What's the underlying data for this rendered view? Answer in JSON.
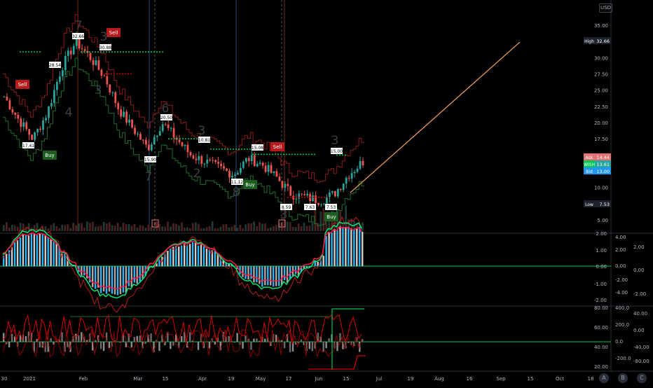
{
  "currency_button": "USD",
  "colors": {
    "background": "#000000",
    "up": "#26a69a",
    "down": "#ef5350",
    "green_bright": "#00e676",
    "red_bright": "#ff1744",
    "orange_line": "#f6a35a",
    "axis_text": "#b2b5be"
  },
  "price_axis": {
    "ticks": [
      "35.00",
      "32.50",
      "30.00",
      "27.50",
      "25.00",
      "22.50",
      "20.00",
      "17.50",
      "15.00",
      "12.50",
      "10.00",
      "7.50",
      "5.00"
    ],
    "labels": {
      "high": "High",
      "high_value": "32.66",
      "ask": "Ask",
      "ask_value": "14.44",
      "wish": "WISH",
      "wish_value": "13.61",
      "bid": "Bid",
      "bid_value": "13.00",
      "low": "Low",
      "low_value": "7.53"
    }
  },
  "osc1_axis": {
    "left": [
      "2.00",
      "1.00",
      "0.00",
      "-1.00",
      "-2.00"
    ],
    "mid": [
      "4.00",
      "2.00",
      "0.00",
      "-2.00",
      "-4.00"
    ],
    "right": [
      "2.00",
      "0.00",
      "-2.00"
    ]
  },
  "osc2_axis": {
    "left": [
      "80.00",
      "60.00",
      "40.00",
      "20.00"
    ],
    "mid": [
      "400.0",
      "200.0",
      "0.0",
      "-200.0"
    ],
    "right": [
      "40.00",
      "0.00",
      "-40.00",
      "-80.00"
    ]
  },
  "time_axis": [
    "30",
    "2021",
    "Feb",
    "Mar",
    "15",
    "Apr",
    "19",
    "May",
    "17",
    "Jun",
    "15",
    "Jul",
    "19",
    "Aug",
    "16",
    "Sep",
    "15",
    "Oct",
    "18"
  ],
  "bottom_buttons": [
    "A",
    "B",
    "C"
  ],
  "annotations": {
    "sell": "Sell",
    "buy": "Buy",
    "price_tags": [
      "32.66",
      "28.54",
      "30.88",
      "17.41",
      "20.50",
      "10.81",
      "15.90",
      "15.08",
      "11.12",
      "8.59",
      "7.53",
      "7.63",
      "15.00"
    ],
    "digits": [
      "7",
      "3",
      "4",
      "3",
      "6",
      "3",
      "7",
      "2",
      "8",
      "3",
      "3"
    ],
    "event_marker": "E"
  },
  "chart_data": {
    "type": "line",
    "title": "",
    "symbol": "WISH",
    "xlabel": "",
    "ylabel": "USD",
    "ylim": [
      4,
      36
    ],
    "x": [
      "2020-12-30",
      "2021-01-05",
      "2021-01-12",
      "2021-01-19",
      "2021-01-26",
      "2021-02-02",
      "2021-02-09",
      "2021-02-16",
      "2021-02-23",
      "2021-03-02",
      "2021-03-09",
      "2021-03-16",
      "2021-03-23",
      "2021-03-30",
      "2021-04-06",
      "2021-04-13",
      "2021-04-20",
      "2021-04-27",
      "2021-05-04",
      "2021-05-11",
      "2021-05-18",
      "2021-05-25",
      "2021-06-01",
      "2021-06-08",
      "2021-06-15",
      "2021-06-22"
    ],
    "series": [
      {
        "name": "WISH",
        "values": [
          24.0,
          20.5,
          17.5,
          21.5,
          28.5,
          32.5,
          30.0,
          27.0,
          22.0,
          19.0,
          16.0,
          20.0,
          17.5,
          15.0,
          14.0,
          13.0,
          12.0,
          14.5,
          13.5,
          11.5,
          9.0,
          8.5,
          8.0,
          9.0,
          12.0,
          14.0
        ]
      }
    ],
    "high": 32.66,
    "low": 7.53,
    "ask": 14.44,
    "bid": 13.0,
    "last": 13.61
  }
}
